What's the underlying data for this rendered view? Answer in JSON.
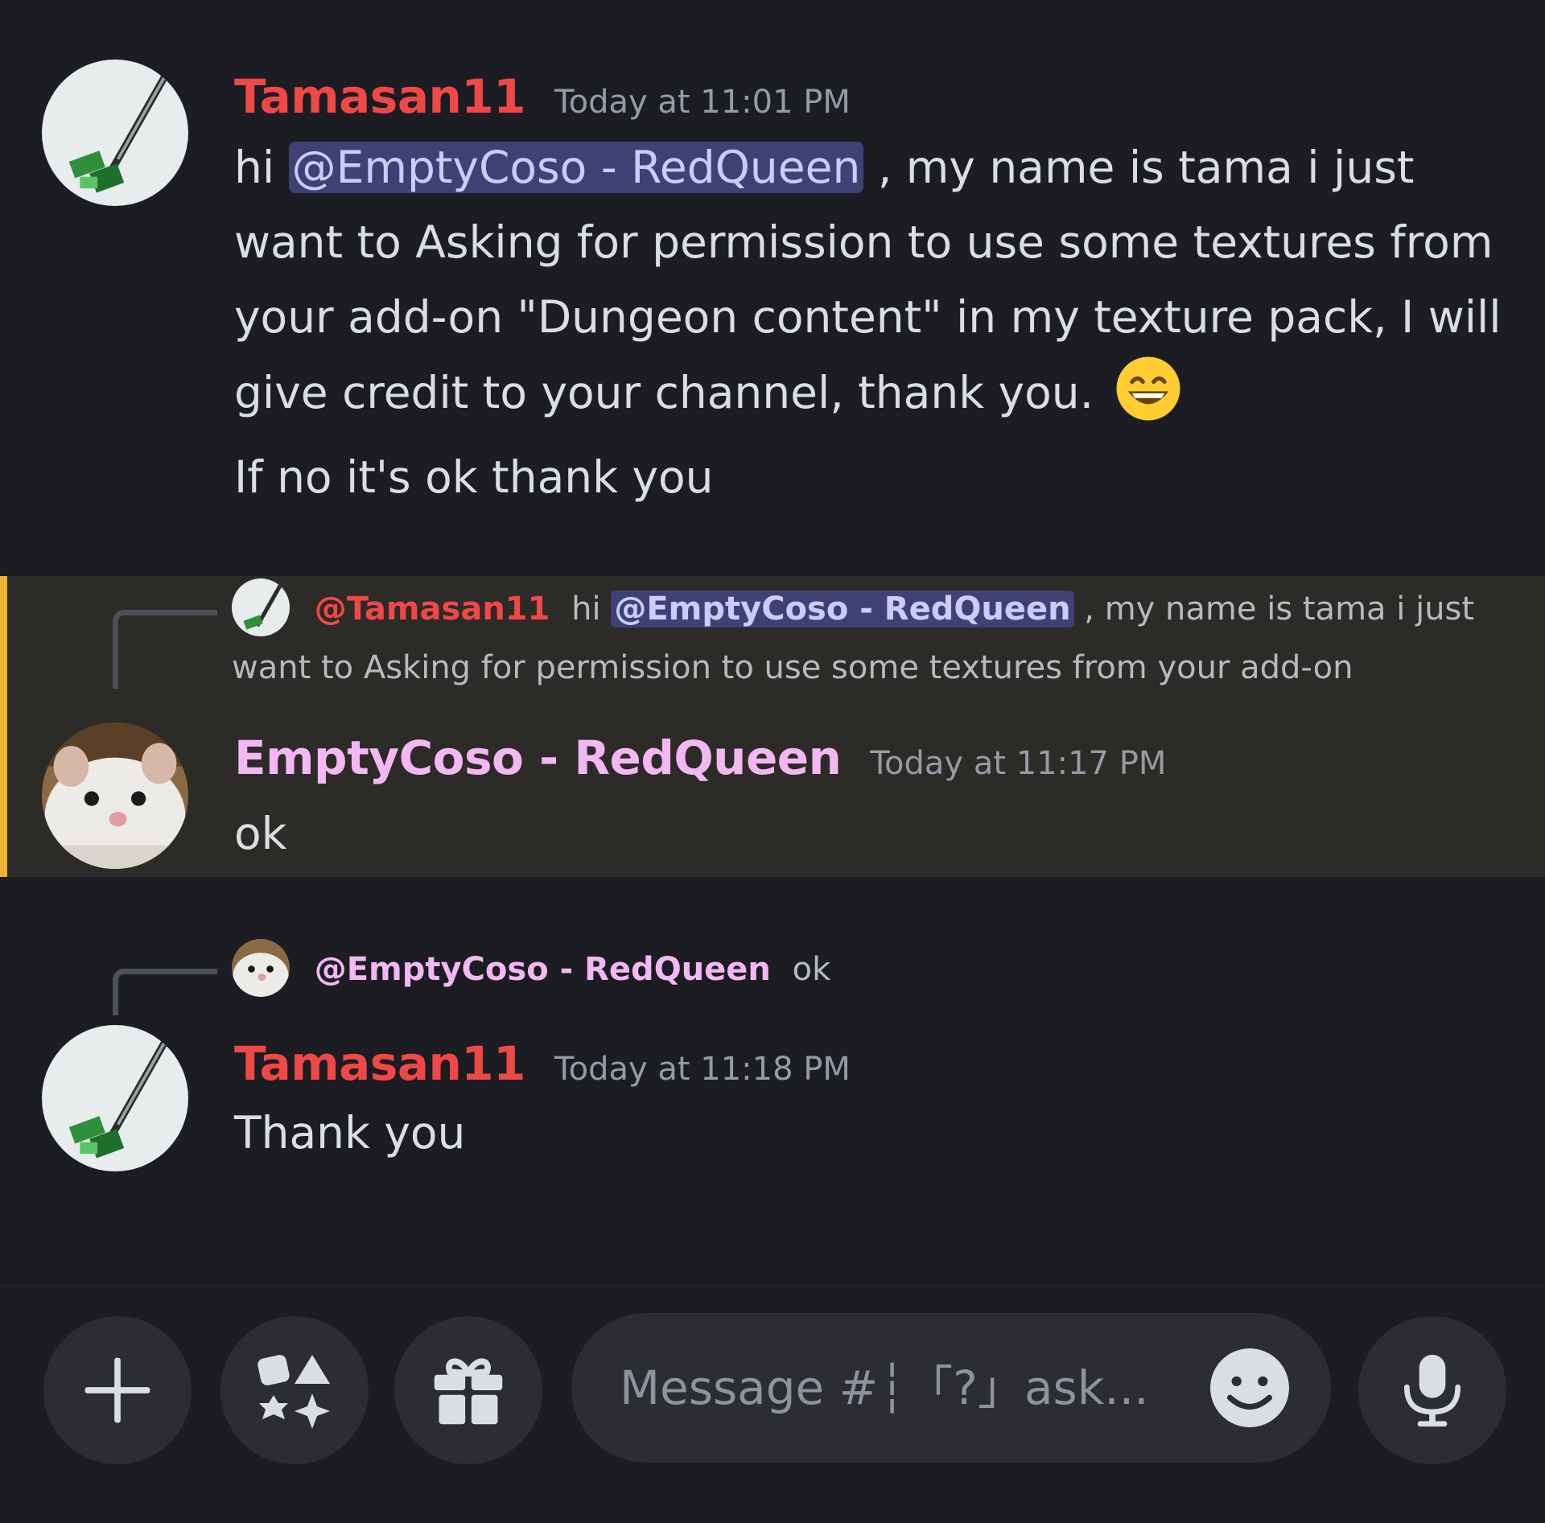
{
  "colors": {
    "background": "#1c1d22",
    "tamasan_name": "#f04747",
    "emptycoso_name": "#f3b8f2",
    "mention_bg": "#3e4173",
    "mention_text": "#c9cdfb",
    "highlight_bg": "#2d2b27",
    "highlight_bar": "#f0b232"
  },
  "messages": [
    {
      "username": "Tamasan11",
      "timestamp": "Today at 11:01 PM",
      "lines": {
        "hi": "hi",
        "mention": "@EmptyCoso - RedQueen",
        "rest1": ", my name is tama i just",
        "line2": "want to Asking for permission to use some textures from",
        "line3": "your add-on \"Dungeon content\" in my texture pack, I will",
        "line4": "give credit to your channel, thank you."
      },
      "emoji": "grinning-face-with-smiling-eyes",
      "second_line": "If no it's ok thank you"
    },
    {
      "reply_to": {
        "username": "@Tamasan11",
        "hi": "hi",
        "mention": "@EmptyCoso - RedQueen",
        "rest1": ", my name is tama i just",
        "line2": "want to Asking for permission to use some textures from your add-on"
      },
      "username": "EmptyCoso - RedQueen",
      "timestamp": "Today at 11:17 PM",
      "text": "ok"
    },
    {
      "reply_to": {
        "username": "@EmptyCoso - RedQueen",
        "text": "ok"
      },
      "username": "Tamasan11",
      "timestamp": "Today at 11:18 PM",
      "text": "Thank you"
    }
  ],
  "composer": {
    "placeholder": "Message #┆「?」ask...",
    "buttons": [
      "plus-icon",
      "apps-icon",
      "gift-icon",
      "emoji-icon",
      "microphone-icon"
    ]
  }
}
